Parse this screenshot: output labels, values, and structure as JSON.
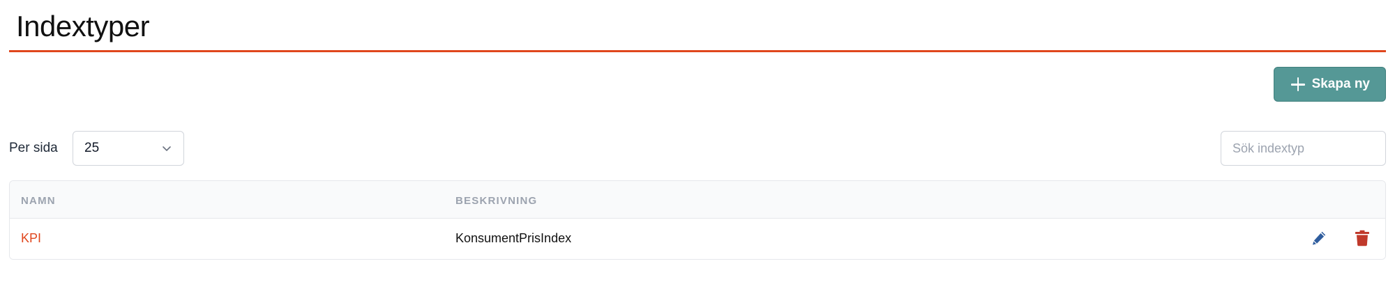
{
  "header": {
    "title": "Indextyper"
  },
  "toolbar": {
    "create_label": "Skapa ny"
  },
  "pagination": {
    "per_page_label": "Per sida",
    "per_page_value": "25"
  },
  "search": {
    "placeholder": "Sök indextyp",
    "value": ""
  },
  "table": {
    "columns": [
      "NAMN",
      "BESKRIVNING"
    ],
    "rows": [
      {
        "name": "KPI",
        "description": "KonsumentPrisIndex"
      }
    ]
  },
  "icons": {
    "create": "plus-icon",
    "select": "chevron-down-icon",
    "edit": "pencil-icon",
    "delete": "trash-icon"
  },
  "colors": {
    "accent": "#e0461d",
    "primary_button": "#559896",
    "edit_icon": "#2f5d9e",
    "delete_icon": "#c0392b"
  }
}
